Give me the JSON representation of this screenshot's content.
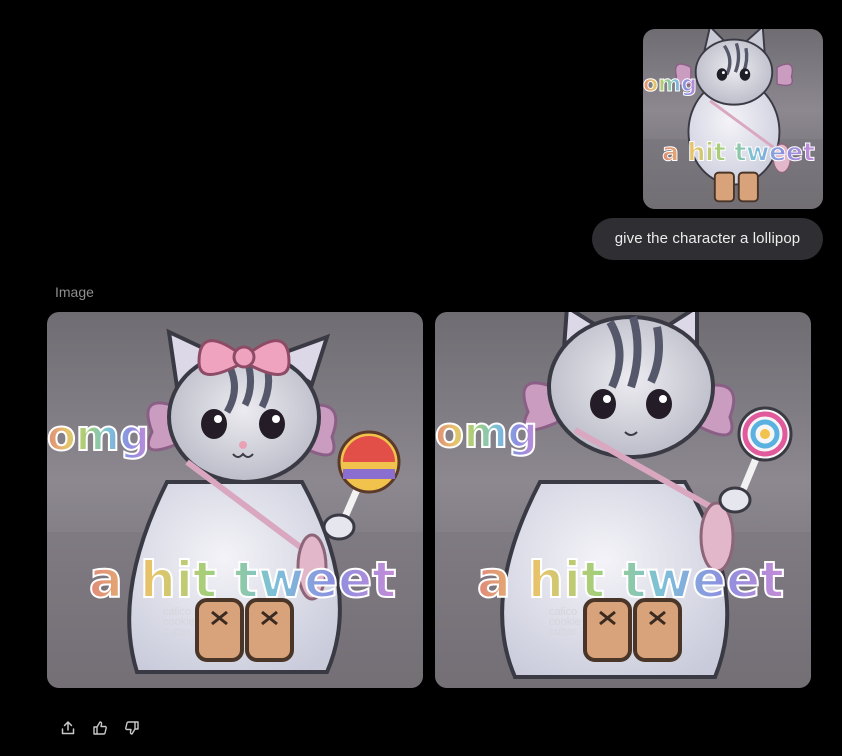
{
  "conversation": {
    "user_message": {
      "text": "give the character a lollipop",
      "attachment_caption_top": "omg",
      "attachment_caption_bottom": "a hit tweet",
      "attachment_watermark": [
        "calico",
        "cookie",
        "cutter"
      ]
    },
    "response": {
      "label": "Image",
      "images": [
        {
          "caption_top": "omg",
          "caption_bottom": "a hit tweet",
          "watermark": [
            "calico",
            "cookie",
            "cutter"
          ],
          "variant": "with-bow"
        },
        {
          "caption_top": "omg",
          "caption_bottom": "a hit tweet",
          "watermark": [
            "calico",
            "cookie",
            "cutter"
          ],
          "variant": "plain"
        }
      ]
    }
  },
  "actions": [
    {
      "icon": "share-icon"
    },
    {
      "icon": "thumbs-up-icon"
    },
    {
      "icon": "thumbs-down-icon"
    }
  ],
  "colors": {
    "background": "#000000",
    "bubble": "#2f2f33",
    "bubble_text": "#ececec",
    "label": "#8e8e8e",
    "icon": "#c8c8c8"
  }
}
